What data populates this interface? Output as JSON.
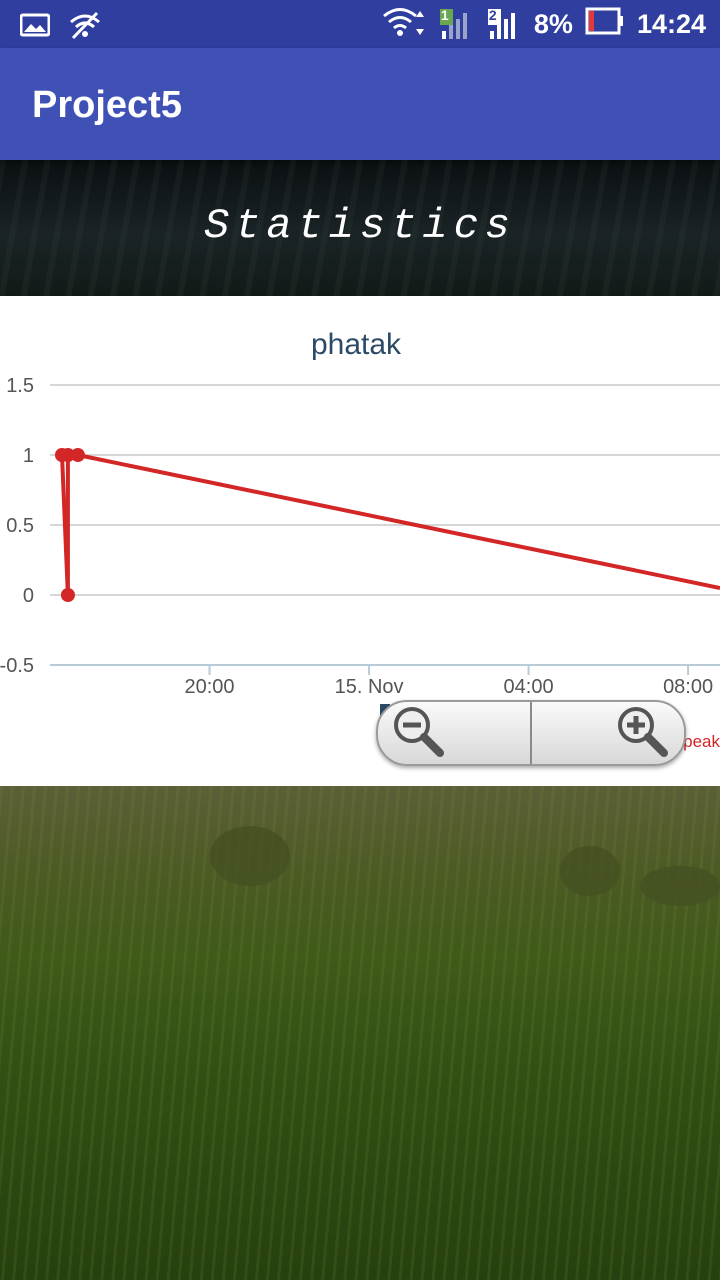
{
  "status_bar": {
    "battery": "8%",
    "time": "14:24",
    "sim1": "1",
    "sim2": "2",
    "icons": [
      "image-icon",
      "wifi-off-icon",
      "wifi-icon",
      "signal-icon",
      "battery-icon"
    ]
  },
  "app_bar": {
    "title": "Project5"
  },
  "banner": {
    "title": "Statistics"
  },
  "chart_data": {
    "type": "line",
    "title": "phatak",
    "x_tick_labels": [
      "20:00",
      "15. Nov",
      "04:00",
      "08:00"
    ],
    "y_tick_labels": [
      "1.5",
      "1",
      "0.5",
      "0",
      "-0.5"
    ],
    "ylim": [
      -0.5,
      1.5
    ],
    "xlim_hours": [
      16.0,
      32.8
    ],
    "series": [
      {
        "name": "peak",
        "color": "#d32626",
        "points": [
          [
            16.3,
            1
          ],
          [
            16.45,
            0
          ],
          [
            16.45,
            1
          ],
          [
            16.7,
            1
          ],
          [
            32.8,
            0.05
          ]
        ]
      }
    ],
    "grid": true,
    "legend_position": "bottom-right"
  },
  "zoom": {
    "out_icon": "zoom-out-icon",
    "in_icon": "zoom-in-icon"
  }
}
